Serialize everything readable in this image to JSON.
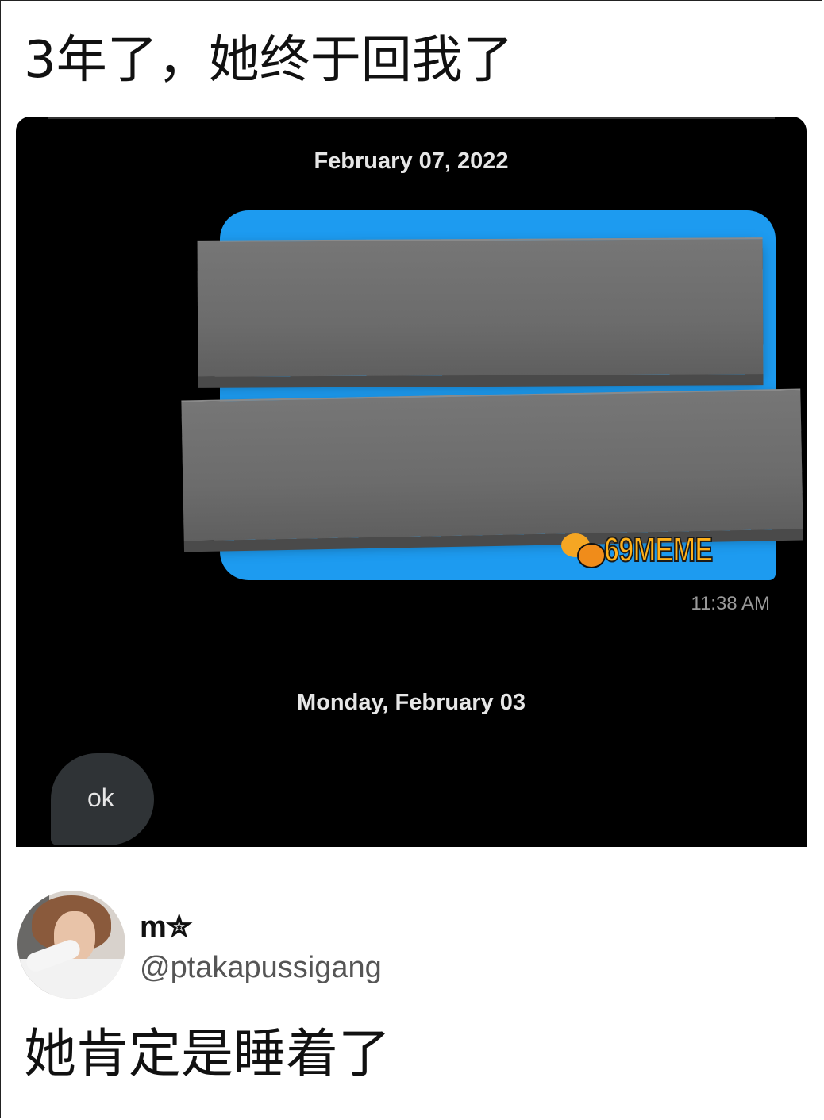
{
  "top_caption": "3年了，她终于回我了",
  "chat": {
    "date_1": "February 07, 2022",
    "sent_time": "11:38 AM",
    "date_2": "Monday, February 03",
    "reply_text": "ok",
    "bubble_color": "#1d9bf0",
    "reply_bubble_color": "#2f3336"
  },
  "watermark": {
    "text": "69MEME",
    "icon": "wechat-icon"
  },
  "tweet": {
    "display_name": "m✮",
    "handle": "@ptakapussigang",
    "text": "她肯定是睡着了"
  }
}
